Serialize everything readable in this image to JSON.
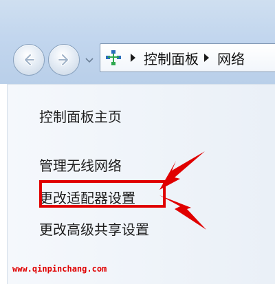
{
  "toolbar": {
    "back_icon": "arrow-left-icon",
    "forward_icon": "arrow-right-icon",
    "history_icon": "chevron-down-icon"
  },
  "address_bar": {
    "icon": "network-icon",
    "breadcrumbs": [
      "控制面板",
      "网络"
    ]
  },
  "left_pane": {
    "links": {
      "home": "控制面板主页",
      "wireless": "管理无线网络",
      "adapter": "更改适配器设置",
      "sharing": "更改高级共享设置"
    }
  },
  "annotation": {
    "highlight_color": "#e00000"
  },
  "watermark": "www.qinpinchang.com"
}
